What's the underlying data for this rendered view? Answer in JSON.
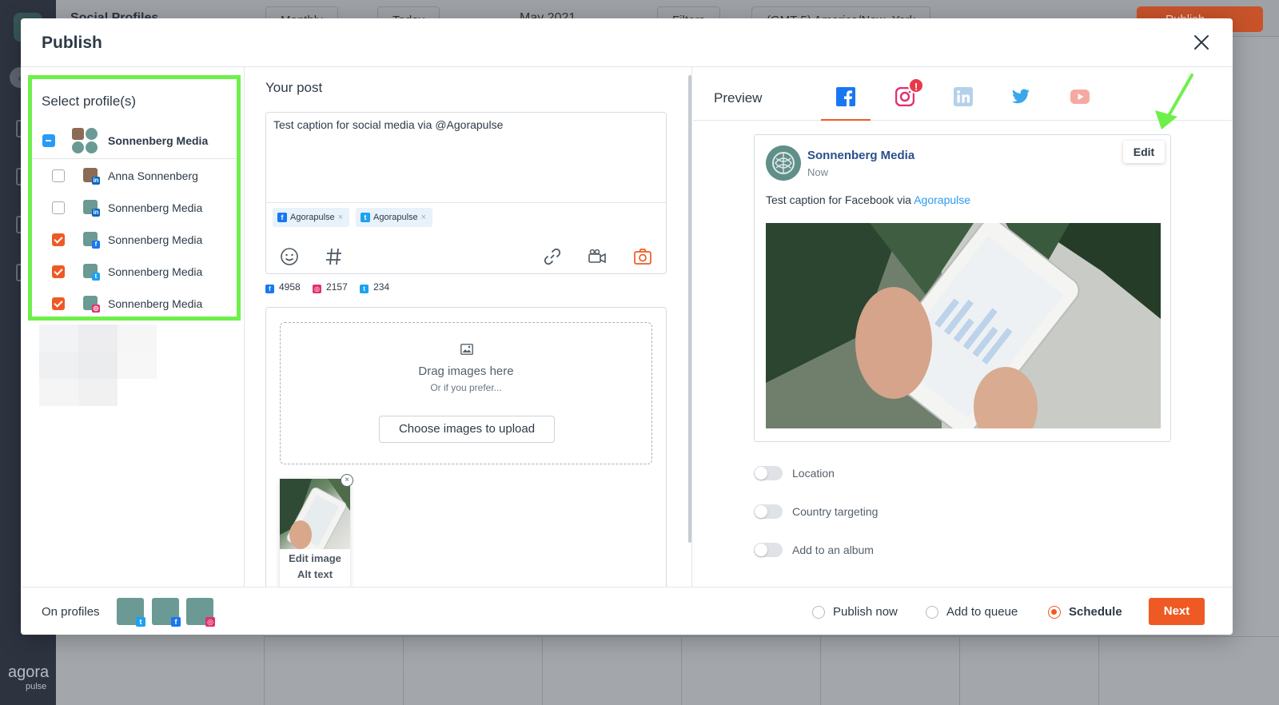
{
  "background": {
    "section_title": "Social Profiles",
    "view_label": "Monthly",
    "today_label": "Today",
    "month_label": "May 2021",
    "filters_label": "Filters",
    "timezone_label": "(GMT-5) America/New_York",
    "publish_label": "Publish",
    "brand": "agora",
    "brand_sub": "pulse"
  },
  "modal": {
    "title": "Publish",
    "close_icon": "close-icon"
  },
  "profiles": {
    "title": "Select profile(s)",
    "group": {
      "name": "Sonnenberg Media",
      "state": "partial"
    },
    "items": [
      {
        "name": "Anna Sonnenberg",
        "network": "linkedin",
        "checked": false
      },
      {
        "name": "Sonnenberg Media",
        "network": "linkedin",
        "checked": false
      },
      {
        "name": "Sonnenberg Media",
        "network": "facebook",
        "checked": true
      },
      {
        "name": "Sonnenberg Media",
        "network": "twitter",
        "checked": true
      },
      {
        "name": "Sonnenberg Media",
        "network": "instagram",
        "checked": true
      }
    ]
  },
  "post": {
    "section_label": "Your post",
    "text": "Test caption for social media via @Agorapulse",
    "mentions": [
      {
        "network": "facebook",
        "label": "Agorapulse"
      },
      {
        "network": "twitter",
        "label": "Agorapulse"
      }
    ],
    "tools": [
      "emoji-icon",
      "hashtag-icon",
      "link-icon",
      "video-icon",
      "camera-icon"
    ],
    "counts": [
      {
        "network": "facebook",
        "value": "4958"
      },
      {
        "network": "instagram",
        "value": "2157"
      },
      {
        "network": "twitter",
        "value": "234"
      }
    ]
  },
  "media": {
    "drop_title": "Drag images here",
    "drop_sub": "Or if you prefer...",
    "upload_label": "Choose images to upload",
    "thumb_edit": "Edit image",
    "thumb_alt": "Alt text"
  },
  "preview": {
    "label": "Preview",
    "tabs": [
      "facebook",
      "instagram",
      "linkedin",
      "twitter",
      "youtube"
    ],
    "active_tab": "facebook",
    "alert_badge": "!",
    "account_name": "Sonnenberg Media",
    "time": "Now",
    "caption_prefix": "Test caption for Facebook via ",
    "caption_link": "Agorapulse",
    "edit_label": "Edit",
    "toggles": [
      {
        "label": "Location",
        "on": false
      },
      {
        "label": "Country targeting",
        "on": false
      },
      {
        "label": "Add to an album",
        "on": false
      }
    ]
  },
  "footer": {
    "on_profiles_label": "On profiles",
    "profile_networks": [
      "twitter",
      "facebook",
      "instagram"
    ],
    "options": [
      {
        "label": "Publish now",
        "selected": false
      },
      {
        "label": "Add to queue",
        "selected": false
      },
      {
        "label": "Schedule",
        "selected": true
      }
    ],
    "next_label": "Next"
  },
  "colors": {
    "accent": "#ef5a24",
    "facebook": "#1877f2",
    "instagram": "#e1306c",
    "twitter": "#1da1f2",
    "linkedin": "#0a66c2",
    "highlight": "#6ef04a"
  }
}
